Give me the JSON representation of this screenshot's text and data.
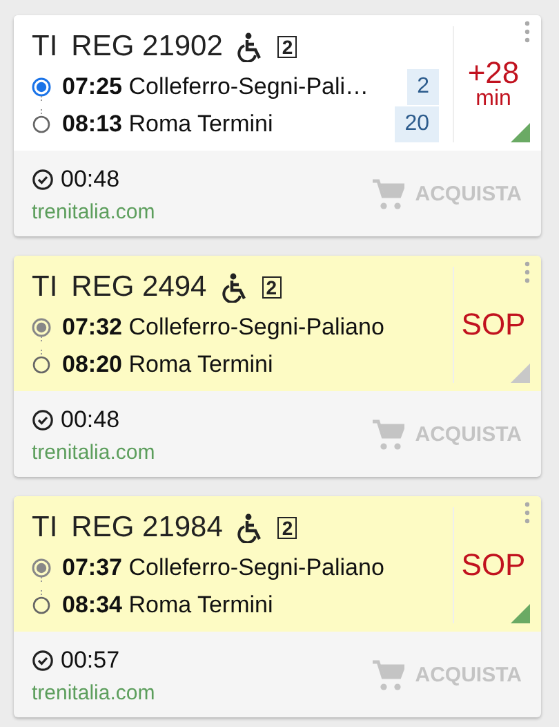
{
  "trains": [
    {
      "operator": "TI",
      "number": "REG 21902",
      "class_badge": "2",
      "highlighted": false,
      "tracked": true,
      "stops": [
        {
          "time": "07:25",
          "station": "Colleferro-Segni-Pali…",
          "platform": "2"
        },
        {
          "time": "08:13",
          "station": "Roma Termini",
          "platform": "20"
        }
      ],
      "status": {
        "text": "+28",
        "unit": "min",
        "color": "#6aaa64"
      },
      "duration": "00:48",
      "source": "trenitalia.com",
      "buy_label": "ACQUISTA"
    },
    {
      "operator": "TI",
      "number": "REG 2494",
      "class_badge": "2",
      "highlighted": true,
      "tracked": false,
      "stops": [
        {
          "time": "07:32",
          "station": "Colleferro-Segni-Paliano"
        },
        {
          "time": "08:20",
          "station": "Roma Termini"
        }
      ],
      "status": {
        "text": "SOP",
        "color": "#c8c8c8"
      },
      "duration": "00:48",
      "source": "trenitalia.com",
      "buy_label": "ACQUISTA"
    },
    {
      "operator": "TI",
      "number": "REG 21984",
      "class_badge": "2",
      "highlighted": true,
      "tracked": false,
      "stops": [
        {
          "time": "07:37",
          "station": "Colleferro-Segni-Paliano"
        },
        {
          "time": "08:34",
          "station": "Roma Termini"
        }
      ],
      "status": {
        "text": "SOP",
        "color": "#6aaa64"
      },
      "duration": "00:57",
      "source": "trenitalia.com",
      "buy_label": "ACQUISTA"
    }
  ]
}
